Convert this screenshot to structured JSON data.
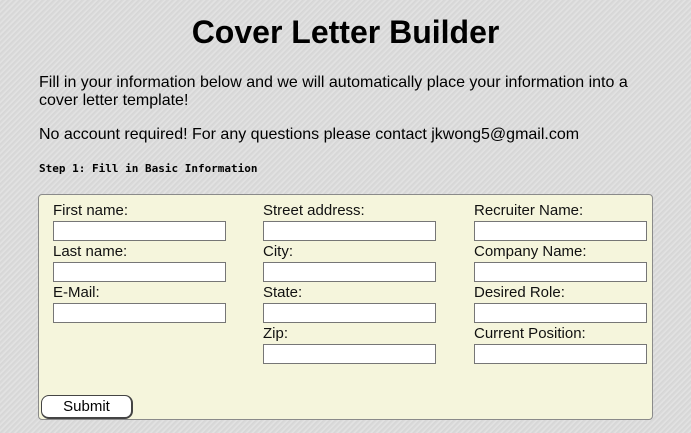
{
  "page": {
    "title": "Cover Letter Builder",
    "intro": "Fill in your information below and we will automatically place your information into a cover letter template!",
    "contact": "No account required! For any questions please contact jkwong5@gmail.com",
    "step_label": "Step 1: Fill in Basic Information"
  },
  "form": {
    "columns": [
      [
        {
          "label": "First name:",
          "value": ""
        },
        {
          "label": "Last name:",
          "value": ""
        },
        {
          "label": "E-Mail:",
          "value": ""
        }
      ],
      [
        {
          "label": "Street address:",
          "value": ""
        },
        {
          "label": "City:",
          "value": ""
        },
        {
          "label": "State:",
          "value": ""
        },
        {
          "label": "Zip:",
          "value": ""
        }
      ],
      [
        {
          "label": "Recruiter Name:",
          "value": ""
        },
        {
          "label": "Company Name:",
          "value": ""
        },
        {
          "label": "Desired Role:",
          "value": ""
        },
        {
          "label": "Current Position:",
          "value": ""
        }
      ]
    ],
    "submit_label": "Submit"
  },
  "colors": {
    "panel_bg": "#f5f5dc",
    "page_bg": "#dcdcdc"
  }
}
